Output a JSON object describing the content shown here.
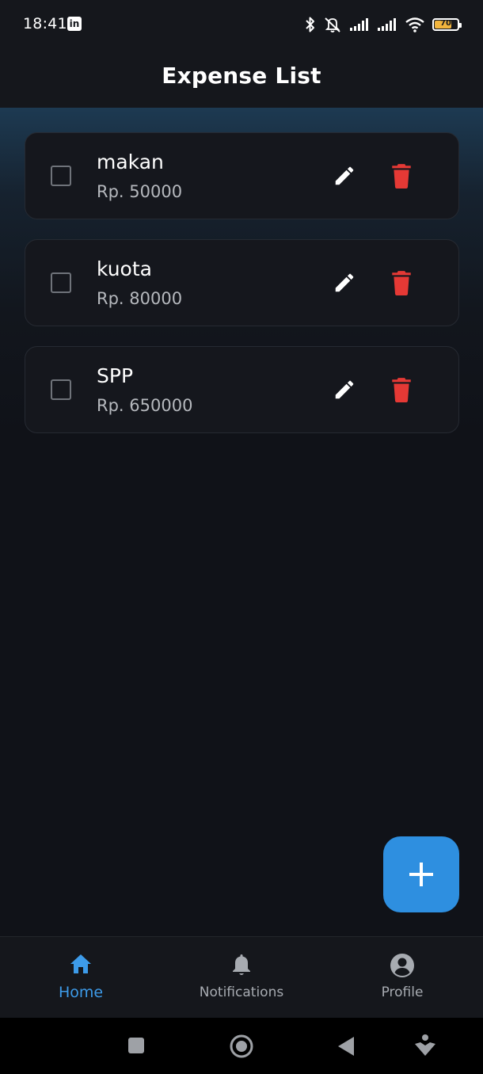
{
  "status_bar": {
    "time": "18:41",
    "linkedin_glyph": "in",
    "battery_level": "70",
    "icons": [
      "bluetooth-icon",
      "silent-icon",
      "signal-icon",
      "signal-icon",
      "wifi-icon",
      "battery-icon"
    ]
  },
  "app_bar": {
    "title": "Expense List"
  },
  "expenses": [
    {
      "name": "makan",
      "amount": "Rp. 50000",
      "checked": false
    },
    {
      "name": "kuota",
      "amount": "Rp. 80000",
      "checked": false
    },
    {
      "name": "SPP",
      "amount": "Rp. 650000",
      "checked": false
    }
  ],
  "fab": {
    "icon": "plus-icon"
  },
  "bottom_nav": {
    "items": [
      {
        "label": "Home",
        "icon": "home-icon",
        "active": true
      },
      {
        "label": "Notifications",
        "icon": "bell-icon",
        "active": false
      },
      {
        "label": "Profile",
        "icon": "account-circle-icon",
        "active": false
      }
    ]
  },
  "colors": {
    "accent": "#2e8fe0",
    "active_nav": "#3d9be9",
    "delete": "#e53935",
    "battery": "#f2b53d"
  }
}
